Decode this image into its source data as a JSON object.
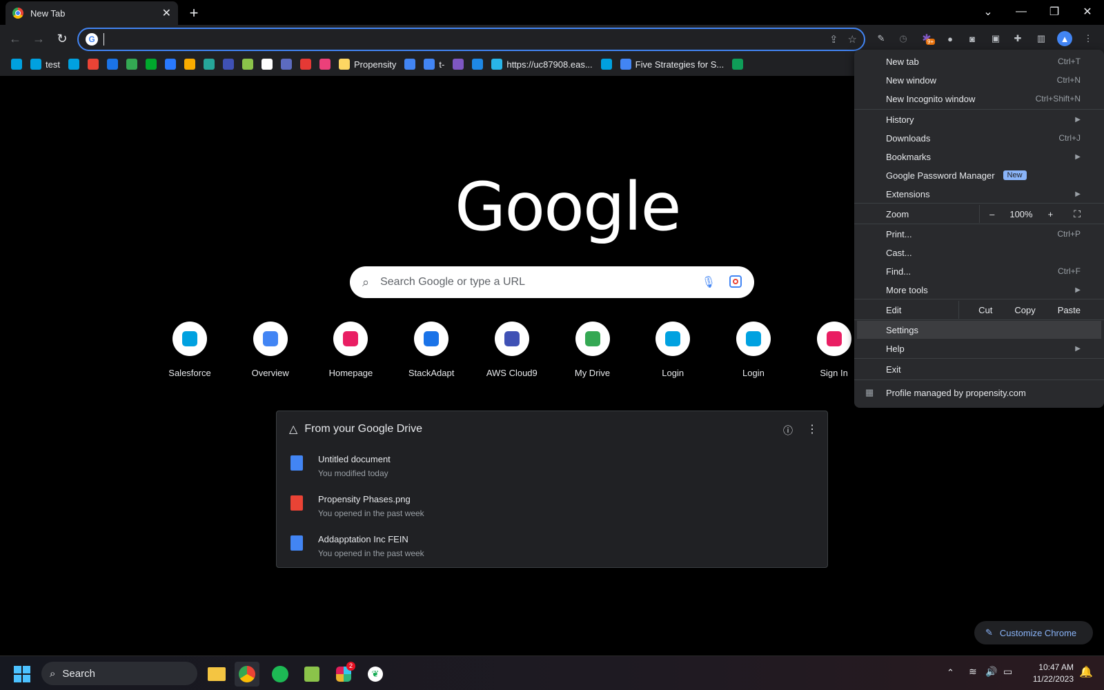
{
  "tab": {
    "title": "New Tab",
    "close": "✕"
  },
  "window_controls": {
    "tab_search": "⌄",
    "minimize": "—",
    "restore": "❐",
    "close": "✕"
  },
  "omnibox": {
    "value": ""
  },
  "bookmarks": [
    {
      "label": "",
      "color": "#00a1e0"
    },
    {
      "label": "test",
      "color": "#00a1e0"
    },
    {
      "label": "",
      "color": "#00a1e0"
    },
    {
      "label": "",
      "color": "#ea4335"
    },
    {
      "label": "",
      "color": "#1a73e8"
    },
    {
      "label": "",
      "color": "#34a853"
    },
    {
      "label": "",
      "color": "#00a82d"
    },
    {
      "label": "",
      "color": "#2979ff"
    },
    {
      "label": "",
      "color": "#f9ab00"
    },
    {
      "label": "",
      "color": "#26a69a"
    },
    {
      "label": "",
      "color": "#3f51b5"
    },
    {
      "label": "",
      "color": "#8bc34a"
    },
    {
      "label": "",
      "color": "#ffffff"
    },
    {
      "label": "",
      "color": "#5c6bc0"
    },
    {
      "label": "",
      "color": "#e53935"
    },
    {
      "label": "",
      "color": "#ec407a"
    },
    {
      "label": "Propensity",
      "color": "#fdd663"
    },
    {
      "label": "",
      "color": "#4285f4"
    },
    {
      "label": "t-",
      "color": "#4285f4"
    },
    {
      "label": "",
      "color": "#7e57c2"
    },
    {
      "label": "",
      "color": "#1e88e5"
    },
    {
      "label": "https://uc87908.eas...",
      "color": "#29b5e8"
    },
    {
      "label": "",
      "color": "#00a1e0"
    },
    {
      "label": "Five Strategies for S...",
      "color": "#4285f4"
    },
    {
      "label": "",
      "color": "#0f9d58"
    }
  ],
  "google": {
    "logo": "Google",
    "search_placeholder": "Search Google or type a URL"
  },
  "shortcuts": [
    {
      "label": "Salesforce",
      "icon": "salesforce-icon",
      "color": "#00a1e0"
    },
    {
      "label": "Overview",
      "icon": "arrow-a-icon",
      "color": "#4285f4"
    },
    {
      "label": "Homepage",
      "icon": "a-box-icon",
      "color": "#e91e63"
    },
    {
      "label": "StackAdapt",
      "icon": "stackadapt-icon",
      "color": "#1a73e8"
    },
    {
      "label": "AWS Cloud9",
      "icon": "cloud9-icon",
      "color": "#3f51b5"
    },
    {
      "label": "My Drive",
      "icon": "google-drive-icon",
      "color": "#34a853"
    },
    {
      "label": "Login",
      "icon": "salesforce-icon",
      "color": "#00a1e0"
    },
    {
      "label": "Login",
      "icon": "salesforce-icon",
      "color": "#00a1e0"
    },
    {
      "label": "Sign In",
      "icon": "a-box-icon",
      "color": "#e91e63"
    }
  ],
  "drive": {
    "title": "From your Google Drive",
    "items": [
      {
        "name": "Untitled document",
        "sub": "You modified today",
        "color": "#4285f4"
      },
      {
        "name": "Propensity Phases.png",
        "sub": "You opened in the past week",
        "color": "#ea4335"
      },
      {
        "name": "Addapptation Inc FEIN",
        "sub": "You opened in the past week",
        "color": "#4285f4"
      }
    ]
  },
  "customize": {
    "label": "Customize Chrome"
  },
  "menu": {
    "new_tab": {
      "label": "New tab",
      "shortcut": "Ctrl+T"
    },
    "new_window": {
      "label": "New window",
      "shortcut": "Ctrl+N"
    },
    "new_incognito": {
      "label": "New Incognito window",
      "shortcut": "Ctrl+Shift+N"
    },
    "history": {
      "label": "History"
    },
    "downloads": {
      "label": "Downloads",
      "shortcut": "Ctrl+J"
    },
    "bookmarks": {
      "label": "Bookmarks"
    },
    "password_manager": {
      "label": "Google Password Manager",
      "badge": "New"
    },
    "extensions": {
      "label": "Extensions"
    },
    "zoom": {
      "label": "Zoom",
      "minus": "–",
      "value": "100%",
      "plus": "+"
    },
    "print": {
      "label": "Print...",
      "shortcut": "Ctrl+P"
    },
    "cast": {
      "label": "Cast..."
    },
    "find": {
      "label": "Find...",
      "shortcut": "Ctrl+F"
    },
    "more_tools": {
      "label": "More tools"
    },
    "edit": {
      "label": "Edit",
      "cut": "Cut",
      "copy": "Copy",
      "paste": "Paste"
    },
    "settings": {
      "label": "Settings"
    },
    "help": {
      "label": "Help"
    },
    "exit": {
      "label": "Exit"
    },
    "managed": {
      "label": "Profile managed by propensity.com"
    }
  },
  "taskbar": {
    "search": "Search",
    "slack_badge": "2",
    "time": "10:47 AM",
    "date": "11/22/2023"
  },
  "extension_badge": "9+"
}
